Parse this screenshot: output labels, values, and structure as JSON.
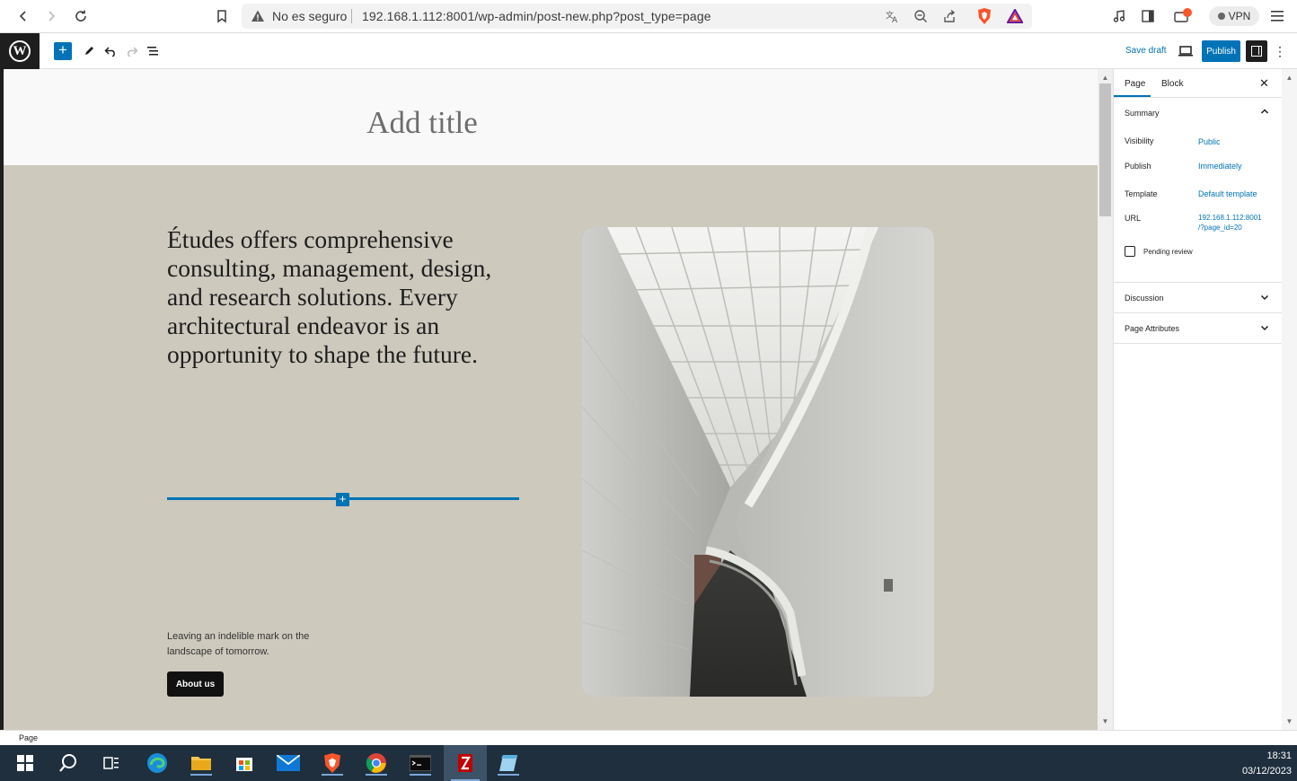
{
  "browser": {
    "security_text": "No es seguro",
    "url": "192.168.1.112:8001/wp-admin/post-new.php?post_type=page",
    "vpn_label": "VPN"
  },
  "editor": {
    "save_draft": "Save draft",
    "publish": "Publish"
  },
  "canvas": {
    "title_placeholder": "Add title",
    "hero_text": "Études offers comprehensive consulting, management, design, and research solutions. Every architectural endeavor is an opportunity to shape the future.",
    "tagline": "Leaving an indelible mark on the landscape of tomorrow.",
    "about_button": "About us"
  },
  "sidebar": {
    "tabs": [
      {
        "label": "Page"
      },
      {
        "label": "Block"
      }
    ],
    "summary": {
      "heading": "Summary",
      "visibility_label": "Visibility",
      "visibility_value": "Public",
      "publish_label": "Publish",
      "publish_value": "Immediately",
      "template_label": "Template",
      "template_value": "Default template",
      "url_label": "URL",
      "url_line1": "192.168.1.112:8001",
      "url_line2": "/?page_id=20",
      "pending_label": "Pending review"
    },
    "discussion": "Discussion",
    "page_attributes": "Page Attributes"
  },
  "statusbar": {
    "breadcrumb": "Page"
  },
  "taskbar": {
    "time": "18:31",
    "date": "03/12/2023"
  },
  "colors": {
    "accent": "#0073b7",
    "canvas_bg": "#cdc9bd",
    "taskbar_bg": "#1f2f3e"
  }
}
